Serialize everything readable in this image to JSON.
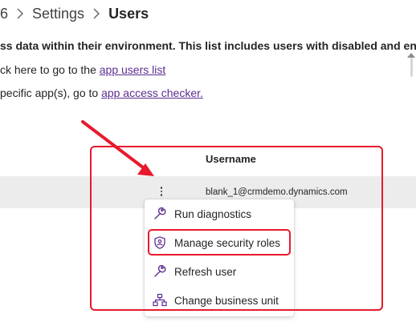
{
  "breadcrumb": {
    "items": [
      "6",
      "Settings",
      "Users"
    ]
  },
  "description": "ss data within their environment. This list includes users with disabled and enal",
  "links": [
    {
      "prefix": "ck here to go to the ",
      "link_text": "app users list"
    },
    {
      "prefix": "pecific app(s), go to ",
      "link_text": "app access checker."
    }
  ],
  "table": {
    "columns": [
      "Username"
    ],
    "rows": [
      {
        "username": "blank_1@crmdemo.dynamics.com"
      }
    ]
  },
  "context_menu": {
    "items": [
      {
        "label": "Run diagnostics",
        "icon": "wrench-icon"
      },
      {
        "label": "Manage security roles",
        "icon": "shield-person-icon"
      },
      {
        "label": "Refresh user",
        "icon": "wrench-icon"
      },
      {
        "label": "Change business unit",
        "icon": "org-chart-icon"
      }
    ]
  },
  "colors": {
    "annotation_red": "#e8192c",
    "link_purple": "#5c2d91",
    "icon_purple": "#5c2d91",
    "row_background": "#ececec"
  }
}
